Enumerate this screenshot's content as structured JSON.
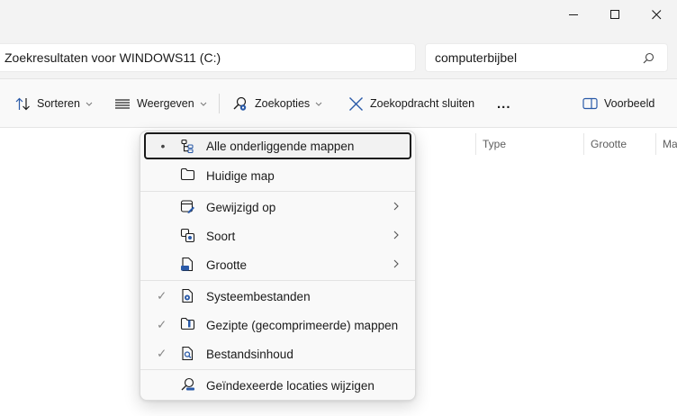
{
  "address": {
    "text": "Zoekresultaten voor WINDOWS11 (C:)"
  },
  "search": {
    "value": "computerbijbel"
  },
  "toolbar": {
    "sort_label": "Sorteren",
    "view_label": "Weergeven",
    "search_options_label": "Zoekopties",
    "close_search_label": "Zoekopdracht sluiten",
    "more_label": "...",
    "preview_label": "Voorbeeld"
  },
  "columns": [
    "Type",
    "Grootte",
    "Ma"
  ],
  "menu": {
    "items": [
      {
        "label": "Alle onderliggende mappen",
        "mark": "•",
        "icon": "subfolders-icon",
        "selected": true
      },
      {
        "label": "Huidige map",
        "mark": "",
        "icon": "folder-icon"
      },
      {
        "label": "Gewijzigd op",
        "mark": "",
        "icon": "calendar-edit-icon",
        "submenu": true
      },
      {
        "label": "Soort",
        "mark": "",
        "icon": "shapes-icon",
        "submenu": true
      },
      {
        "label": "Grootte",
        "mark": "",
        "icon": "file-size-icon",
        "submenu": true
      },
      {
        "label": "Systeembestanden",
        "mark": "✓",
        "icon": "system-file-icon"
      },
      {
        "label": "Gezipte (gecomprimeerde) mappen",
        "mark": "✓",
        "icon": "zip-folder-icon"
      },
      {
        "label": "Bestandsinhoud",
        "mark": "✓",
        "icon": "file-search-icon"
      },
      {
        "label": "Geïndexeerde locaties wijzigen",
        "mark": "",
        "icon": "index-search-icon"
      }
    ]
  },
  "colors": {
    "accent": "#0067c0",
    "menu_bg": "#f9f9f9",
    "toolbar_bg": "#f9f9f9",
    "chrome_bg": "#f3f3f3"
  }
}
